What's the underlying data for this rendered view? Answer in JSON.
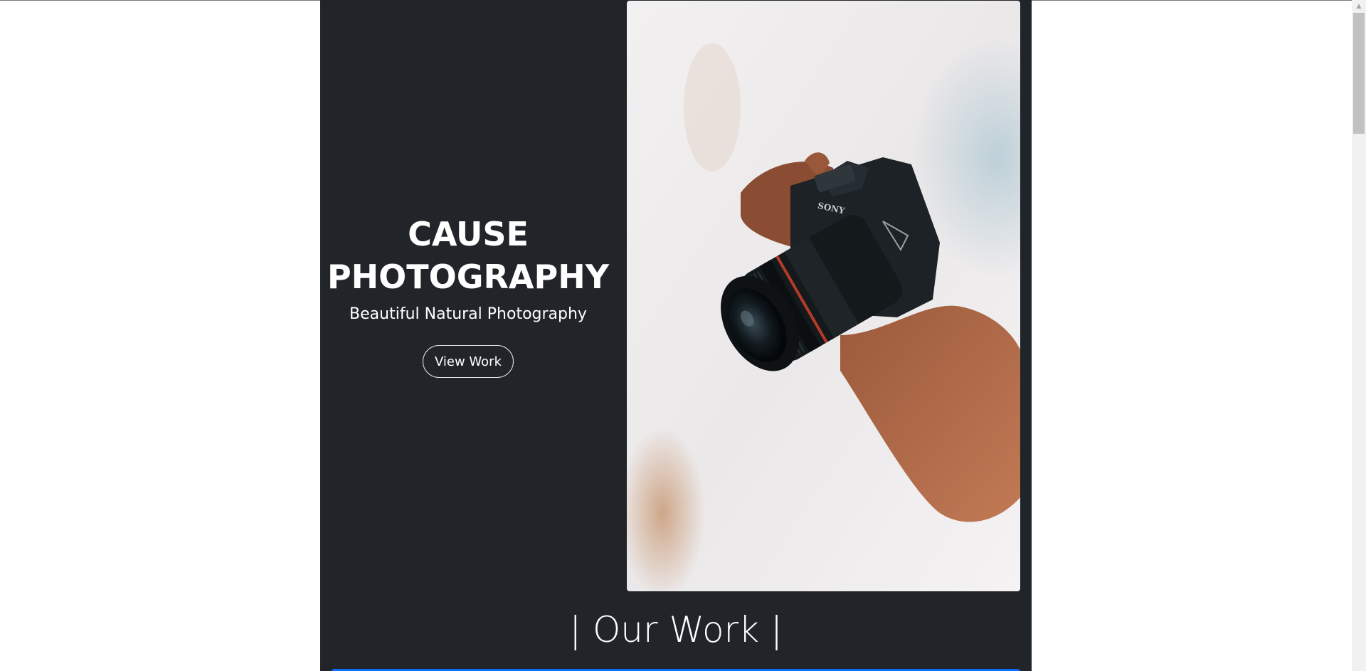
{
  "hero": {
    "title": "CAUSE PHOTOGRAPHY",
    "subtitle": "Beautiful Natural Photography",
    "button_label": "View Work",
    "image_alt": "hand-holding-camera-photo",
    "camera_brand": "SONY"
  },
  "sections": {
    "work_title": "| Our Work |"
  },
  "colors": {
    "page_background": "#212529",
    "outer_background": "#ffffff",
    "text": "#ffffff",
    "accent": "#0d6efd"
  },
  "scrollbar": {
    "up_arrow_icon": "triangle-up-icon"
  }
}
